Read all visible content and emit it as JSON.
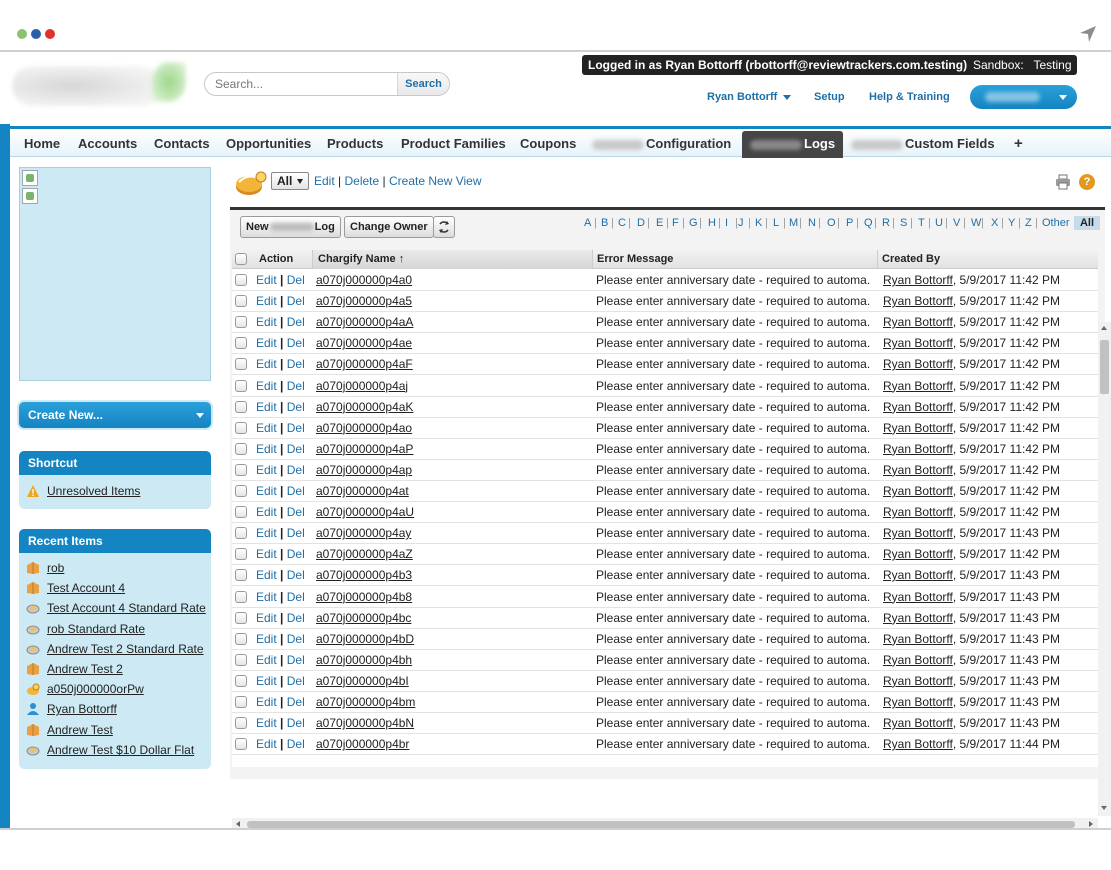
{
  "header": {
    "search_placeholder": "Search...",
    "search_button": "Search",
    "logged_in": "Logged in as Ryan Bottorff (rbottorff@reviewtrackers.com.testing)",
    "sandbox": "Sandbox:   Testing",
    "user_menu": "Ryan Bottorff",
    "setup": "Setup",
    "help": "Help & Training"
  },
  "tabs": [
    {
      "label": "Home"
    },
    {
      "label": "Accounts"
    },
    {
      "label": "Contacts"
    },
    {
      "label": "Opportunities"
    },
    {
      "label": "Products"
    },
    {
      "label": "Product Families"
    },
    {
      "label": "Coupons"
    },
    {
      "label": "Configuration"
    },
    {
      "label": "Logs"
    },
    {
      "label": "Custom Fields"
    },
    {
      "label": "+"
    }
  ],
  "sidebar": {
    "create_new": "Create New...",
    "shortcut_title": "Shortcut",
    "shortcut_item": "Unresolved Items",
    "recent_title": "Recent Items",
    "recent_items": [
      {
        "label": "rob",
        "icon": "account-icon"
      },
      {
        "label": "Test Account 4",
        "icon": "account-icon"
      },
      {
        "label": "Test Account 4 Standard Rate",
        "icon": "rate-plan-icon"
      },
      {
        "label": "rob Standard Rate",
        "icon": "rate-plan-icon"
      },
      {
        "label": "Andrew Test 2 Standard Rate",
        "icon": "rate-plan-icon"
      },
      {
        "label": "Andrew Test 2",
        "icon": "account-icon"
      },
      {
        "label": "a050j000000orPw",
        "icon": "record-icon"
      },
      {
        "label": "Ryan Bottorff",
        "icon": "user-icon"
      },
      {
        "label": "Andrew Test",
        "icon": "account-icon"
      },
      {
        "label": "Andrew Test $10 Dollar Flat",
        "icon": "rate-plan-icon"
      }
    ]
  },
  "view": {
    "selected": "All",
    "edit": "Edit",
    "delete": "Delete",
    "create_new_view": "Create New View",
    "sep": "|"
  },
  "buttons": {
    "new_prefix": "New",
    "new_suffix": "Log",
    "change_owner": "Change Owner"
  },
  "alpha": [
    "A",
    "B",
    "C",
    "D",
    "E",
    "F",
    "G",
    "H",
    "I",
    "J",
    "K",
    "L",
    "M",
    "N",
    "O",
    "P",
    "Q",
    "R",
    "S",
    "T",
    "U",
    "V",
    "W",
    "X",
    "Y",
    "Z",
    "Other"
  ],
  "alpha_all": "All",
  "columns": {
    "action": "Action",
    "name": "Chargify Name ↑",
    "error": "Error Message",
    "created_by": "Created By"
  },
  "row_edit": "Edit",
  "row_del": "Del",
  "row_sep": "|",
  "error_text": "Please enter anniversary date - required to automa...",
  "created_user": "Ryan Bottorff",
  "rows": [
    {
      "name": "a070j000000p4a0",
      "date": ", 5/9/2017 11:42 PM"
    },
    {
      "name": "a070j000000p4a5",
      "date": ", 5/9/2017 11:42 PM"
    },
    {
      "name": "a070j000000p4aA",
      "date": ", 5/9/2017 11:42 PM"
    },
    {
      "name": "a070j000000p4ae",
      "date": ", 5/9/2017 11:42 PM"
    },
    {
      "name": "a070j000000p4aF",
      "date": ", 5/9/2017 11:42 PM"
    },
    {
      "name": "a070j000000p4aj",
      "date": ", 5/9/2017 11:42 PM"
    },
    {
      "name": "a070j000000p4aK",
      "date": ", 5/9/2017 11:42 PM"
    },
    {
      "name": "a070j000000p4ao",
      "date": ", 5/9/2017 11:42 PM"
    },
    {
      "name": "a070j000000p4aP",
      "date": ", 5/9/2017 11:42 PM"
    },
    {
      "name": "a070j000000p4ap",
      "date": ", 5/9/2017 11:42 PM"
    },
    {
      "name": "a070j000000p4at",
      "date": ", 5/9/2017 11:42 PM"
    },
    {
      "name": "a070j000000p4aU",
      "date": ", 5/9/2017 11:42 PM"
    },
    {
      "name": "a070j000000p4ay",
      "date": ", 5/9/2017 11:43 PM"
    },
    {
      "name": "a070j000000p4aZ",
      "date": ", 5/9/2017 11:42 PM"
    },
    {
      "name": "a070j000000p4b3",
      "date": ", 5/9/2017 11:43 PM"
    },
    {
      "name": "a070j000000p4b8",
      "date": ", 5/9/2017 11:43 PM"
    },
    {
      "name": "a070j000000p4bc",
      "date": ", 5/9/2017 11:43 PM"
    },
    {
      "name": "a070j000000p4bD",
      "date": ", 5/9/2017 11:43 PM"
    },
    {
      "name": "a070j000000p4bh",
      "date": ", 5/9/2017 11:43 PM"
    },
    {
      "name": "a070j000000p4bI",
      "date": ", 5/9/2017 11:43 PM"
    },
    {
      "name": "a070j000000p4bm",
      "date": ", 5/9/2017 11:43 PM"
    },
    {
      "name": "a070j000000p4bN",
      "date": ", 5/9/2017 11:43 PM"
    },
    {
      "name": "a070j000000p4br",
      "date": ", 5/9/2017 11:44 PM"
    }
  ],
  "colors": {
    "brand_blue": "#1584c2",
    "sidebar_bg": "#cdeaf4",
    "link_blue": "#1f6fa7"
  }
}
